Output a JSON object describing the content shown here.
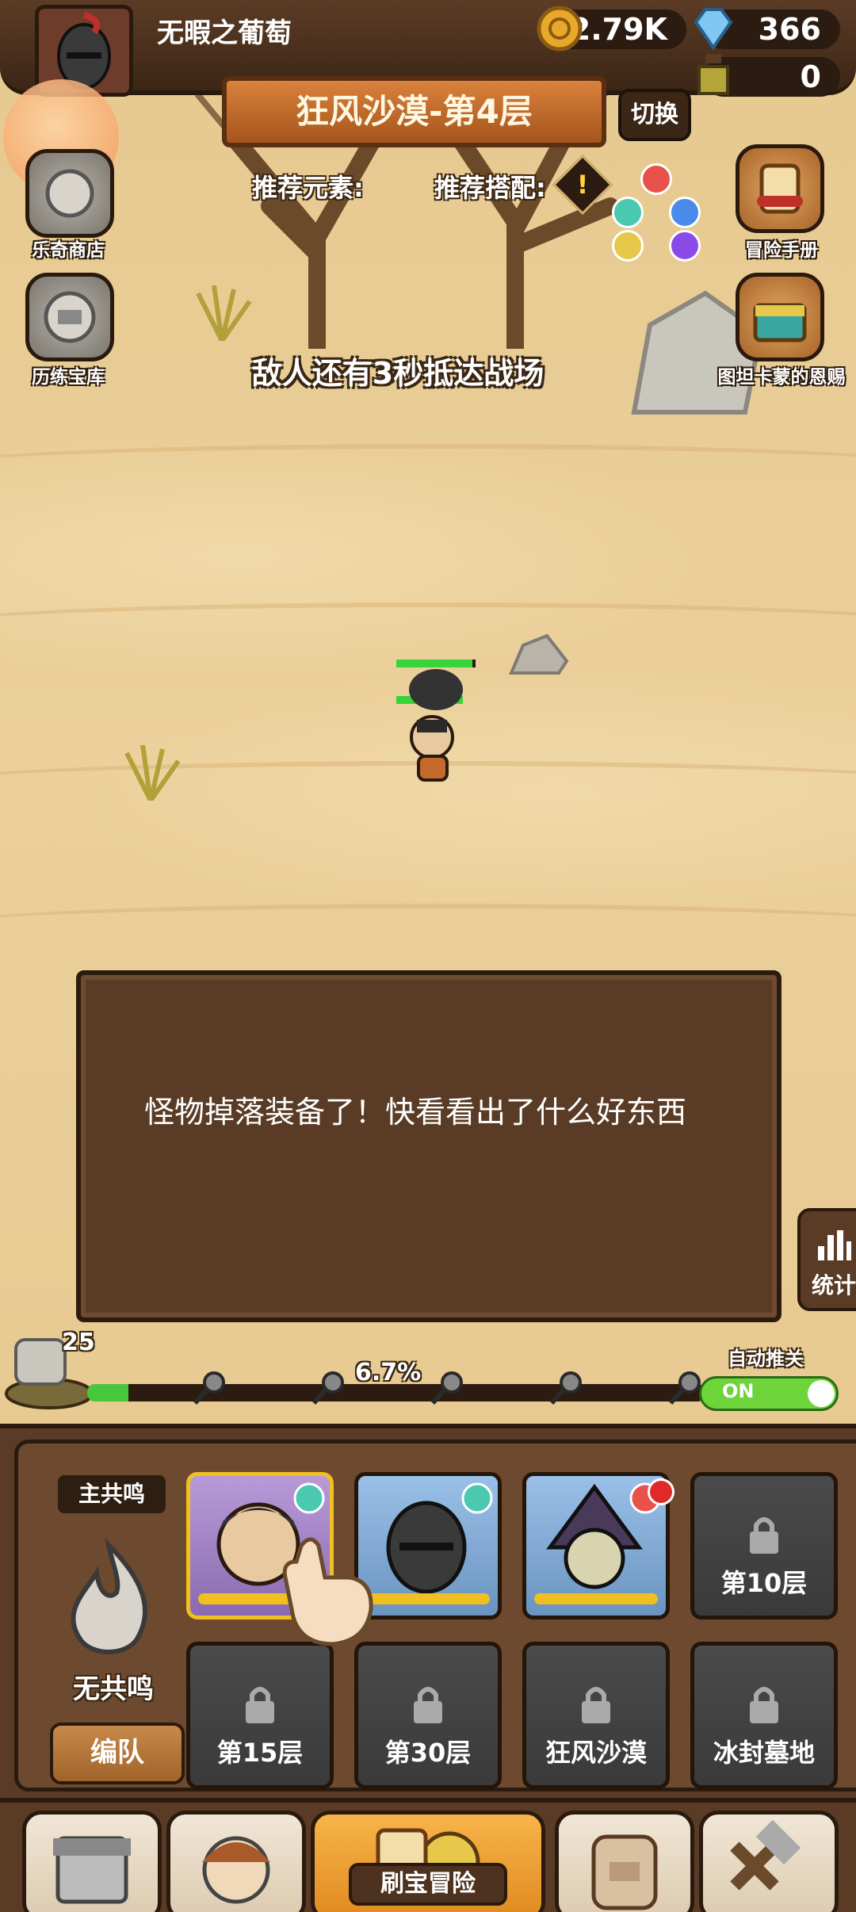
{
  "player": {
    "name": "无暇之葡萄"
  },
  "resources": {
    "gold": "2.79K",
    "diamond": "366",
    "potion": "0"
  },
  "stage": {
    "title": "狂风沙漠-第4层",
    "switch_label": "切换",
    "recommended_elements_label": "推荐元素:",
    "recommended_combo_label": "推荐搭配:",
    "warning_symbol": "!",
    "countdown": "敌人还有3秒抵达战场"
  },
  "side_buttons": {
    "shop": "乐奇商店",
    "vault": "历练宝库",
    "manual": "冒险手册",
    "gift": "图坦卡蒙的恩赐"
  },
  "dialog": {
    "text": "怪物掉落装备了！快看看出了什么好东西"
  },
  "stats_label": "统计",
  "progress": {
    "percent_text": "6.7%",
    "fraction": 0.067,
    "chest_count": "25"
  },
  "auto_advance": {
    "label": "自动推关",
    "state": "ON"
  },
  "team": {
    "resonance_tag": "主共鸣",
    "resonance_status": "无共鸣",
    "formation_button": "编队",
    "locked_slots": [
      "第10层",
      "第15层",
      "第30层",
      "狂风沙漠",
      "冰封墓地"
    ]
  },
  "nav": {
    "main_label": "刷宝冒险"
  },
  "colors": {
    "panel_brown": "#5a3c26",
    "progress_green": "#47c83c",
    "toggle_green": "#6dd43a",
    "banner_orange": "#d9823c"
  }
}
